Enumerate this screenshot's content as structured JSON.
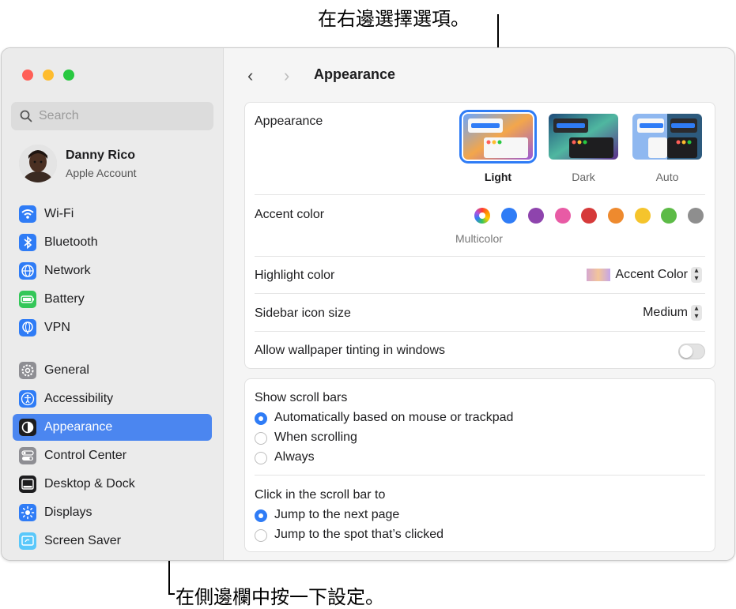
{
  "callouts": {
    "top": "在右邊選擇選項。",
    "bottom": "在側邊欄中按一下設定。"
  },
  "window": {
    "traffic_colors": [
      "#ff5f57",
      "#febc2e",
      "#28c840"
    ]
  },
  "sidebar": {
    "search_placeholder": "Search",
    "account": {
      "name": "Danny Rico",
      "subtitle": "Apple Account"
    },
    "items": [
      {
        "label": "Wi-Fi",
        "icon": "wifi-icon",
        "color": "#2f7cf6"
      },
      {
        "label": "Bluetooth",
        "icon": "bluetooth-icon",
        "color": "#2f7cf6"
      },
      {
        "label": "Network",
        "icon": "globe-icon",
        "color": "#2f7cf6"
      },
      {
        "label": "Battery",
        "icon": "battery-icon",
        "color": "#34c759"
      },
      {
        "label": "VPN",
        "icon": "vpn-globe-icon",
        "color": "#2f7cf6"
      },
      {
        "label": "General",
        "icon": "gear-icon",
        "color": "#8e8e93"
      },
      {
        "label": "Accessibility",
        "icon": "accessibility-icon",
        "color": "#2f7cf6"
      },
      {
        "label": "Appearance",
        "icon": "appearance-icon",
        "color": "#1d1d1f",
        "selected": true
      },
      {
        "label": "Control Center",
        "icon": "control-center-icon",
        "color": "#8e8e93"
      },
      {
        "label": "Desktop & Dock",
        "icon": "dock-icon",
        "color": "#1d1d1f"
      },
      {
        "label": "Displays",
        "icon": "sun-icon",
        "color": "#2f7cf6"
      },
      {
        "label": "Screen Saver",
        "icon": "screen-saver-icon",
        "color": "#5ac8fa"
      }
    ]
  },
  "main": {
    "title": "Appearance",
    "appearance": {
      "label": "Appearance",
      "options": [
        {
          "label": "Light",
          "selected": true
        },
        {
          "label": "Dark",
          "selected": false
        },
        {
          "label": "Auto",
          "selected": false
        }
      ]
    },
    "accent": {
      "label": "Accent color",
      "selected_label": "Multicolor",
      "colors": [
        "multicolor",
        "#2f7cf6",
        "#8e44ad",
        "#e85ba5",
        "#d63a3a",
        "#ee8a2e",
        "#f5c42c",
        "#5dbb47",
        "#8e8e8e"
      ]
    },
    "highlight": {
      "label": "Highlight color",
      "value": "Accent Color"
    },
    "sidebar_icon": {
      "label": "Sidebar icon size",
      "value": "Medium"
    },
    "tinting": {
      "label": "Allow wallpaper tinting in windows",
      "enabled": false
    },
    "scroll_bars": {
      "label": "Show scroll bars",
      "options": [
        {
          "label": "Automatically based on mouse or trackpad",
          "selected": true
        },
        {
          "label": "When scrolling",
          "selected": false
        },
        {
          "label": "Always",
          "selected": false
        }
      ]
    },
    "click_scroll": {
      "label": "Click in the scroll bar to",
      "options": [
        {
          "label": "Jump to the next page",
          "selected": true
        },
        {
          "label": "Jump to the spot that’s clicked",
          "selected": false
        }
      ]
    }
  }
}
